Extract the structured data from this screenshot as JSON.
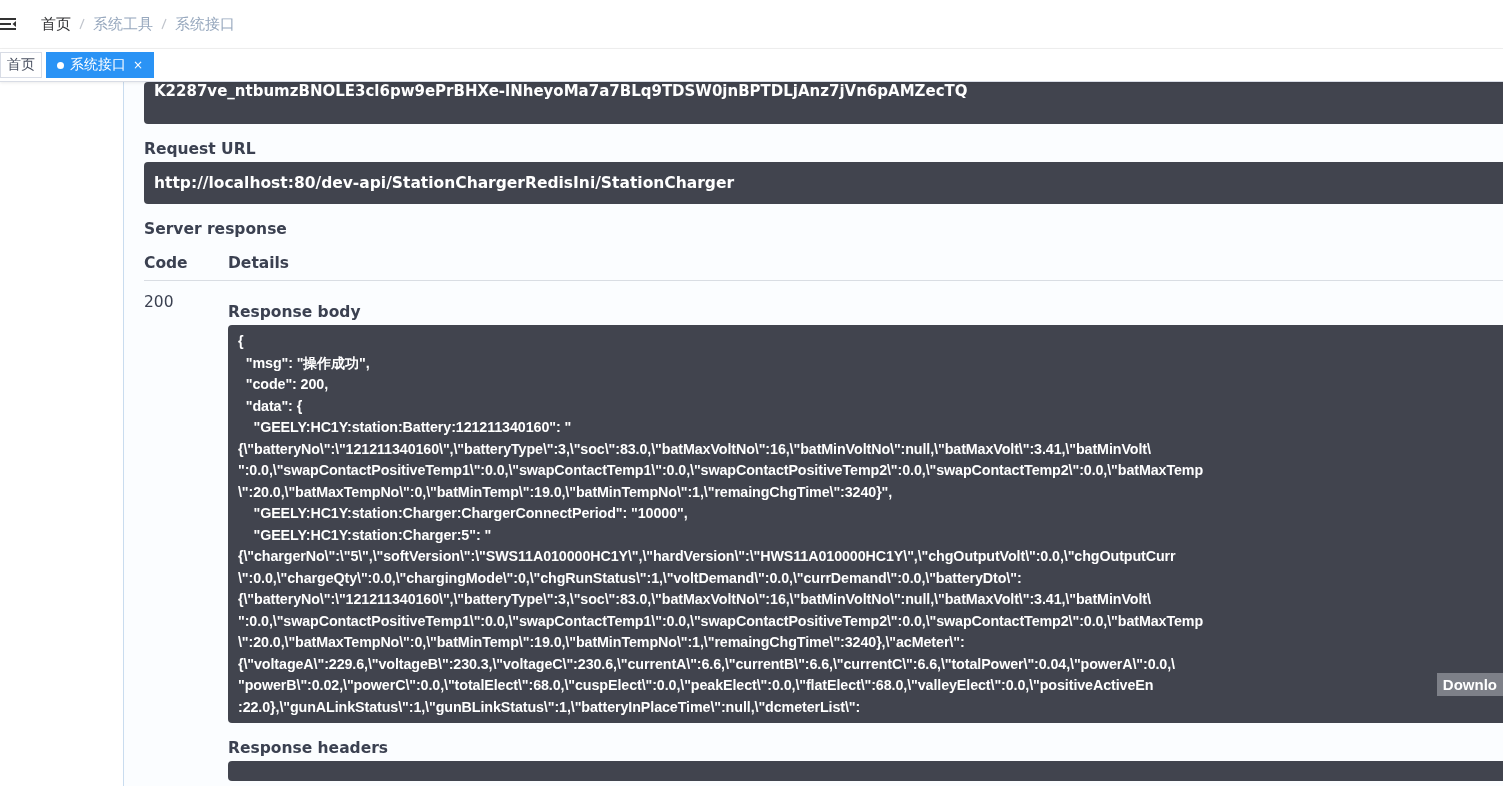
{
  "breadcrumb": [
    {
      "label": "首页",
      "link": true
    },
    {
      "label": "系统工具",
      "link": false
    },
    {
      "label": "系统接口",
      "link": false
    }
  ],
  "tabs": [
    {
      "label": "首页",
      "selected": false
    },
    {
      "label": "系统接口",
      "selected": true,
      "close": "×"
    }
  ],
  "token_tail": "K2287ve_ntbumzBNOLE3cl6pw9ePrBHXe-lNheyoMa7a7BLq9TDSW0jnBPTDLjAnz7jVn6pAMZecTQ",
  "request_url": {
    "label": "Request URL",
    "value": "http://localhost:80/dev-api/StationChargerRedisIni/StationCharger"
  },
  "server_response": {
    "label": "Server response",
    "columns": [
      "Code",
      "Details"
    ],
    "code": "200",
    "body_label": "Response body",
    "body_lines": [
      "{",
      "  \"msg\": \"操作成功\",",
      "  \"code\": 200,",
      "  \"data\": {",
      "    \"GEELY:HC1Y:station:Battery:121211340160\": \"",
      "{\\\"batteryNo\\\":\\\"121211340160\\\",\\\"batteryType\\\":3,\\\"soc\\\":83.0,\\\"batMaxVoltNo\\\":16,\\\"batMinVoltNo\\\":null,\\\"batMaxVolt\\\":3.41,\\\"batMinVolt\\",
      "\":0.0,\\\"swapContactPositiveTemp1\\\":0.0,\\\"swapContactTemp1\\\":0.0,\\\"swapContactPositiveTemp2\\\":0.0,\\\"swapContactTemp2\\\":0.0,\\\"batMaxTemp",
      "\\\":20.0,\\\"batMaxTempNo\\\":0,\\\"batMinTemp\\\":19.0,\\\"batMinTempNo\\\":1,\\\"remaingChgTime\\\":3240}\",",
      "    \"GEELY:HC1Y:station:Charger:ChargerConnectPeriod\": \"10000\",",
      "    \"GEELY:HC1Y:station:Charger:5\": \"",
      "{\\\"chargerNo\\\":\\\"5\\\",\\\"softVersion\\\":\\\"SWS11A010000HC1Y\\\",\\\"hardVersion\\\":\\\"HWS11A010000HC1Y\\\",\\\"chgOutputVolt\\\":0.0,\\\"chgOutputCurr",
      "\\\":0.0,\\\"chargeQty\\\":0.0,\\\"chargingMode\\\":0,\\\"chgRunStatus\\\":1,\\\"voltDemand\\\":0.0,\\\"currDemand\\\":0.0,\\\"batteryDto\\\":",
      "{\\\"batteryNo\\\":\\\"121211340160\\\",\\\"batteryType\\\":3,\\\"soc\\\":83.0,\\\"batMaxVoltNo\\\":16,\\\"batMinVoltNo\\\":null,\\\"batMaxVolt\\\":3.41,\\\"batMinVolt\\",
      "\":0.0,\\\"swapContactPositiveTemp1\\\":0.0,\\\"swapContactTemp1\\\":0.0,\\\"swapContactPositiveTemp2\\\":0.0,\\\"swapContactTemp2\\\":0.0,\\\"batMaxTemp",
      "\\\":20.0,\\\"batMaxTempNo\\\":0,\\\"batMinTemp\\\":19.0,\\\"batMinTempNo\\\":1,\\\"remaingChgTime\\\":3240},\\\"acMeter\\\":",
      "{\\\"voltageA\\\":229.6,\\\"voltageB\\\":230.3,\\\"voltageC\\\":230.6,\\\"currentA\\\":6.6,\\\"currentB\\\":6.6,\\\"currentC\\\":6.6,\\\"totalPower\\\":0.04,\\\"powerA\\\":0.0,\\",
      "\"powerB\\\":0.02,\\\"powerC\\\":0.0,\\\"totalElect\\\":68.0,\\\"cuspElect\\\":0.0,\\\"peakElect\\\":0.0,\\\"flatElect\\\":68.0,\\\"valleyElect\\\":0.0,\\\"positiveActiveEn",
      ":22.0},\\\"gunALinkStatus\\\":1,\\\"gunBLinkStatus\\\":1,\\\"batteryInPlaceTime\\\":null,\\\"dcmeterList\\\":"
    ],
    "download": "Downlo",
    "headers_label": "Response headers"
  }
}
